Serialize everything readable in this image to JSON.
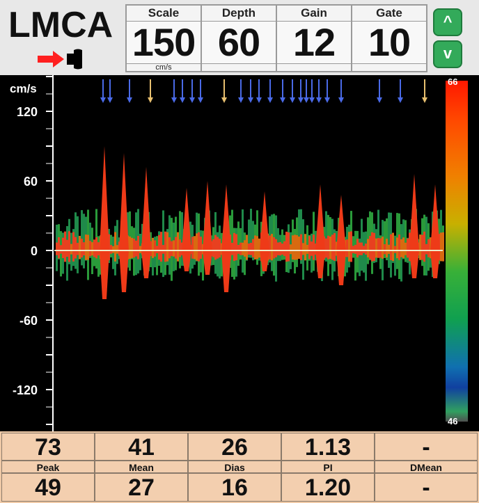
{
  "header": {
    "vessel": "LMCA",
    "scale": {
      "label": "Scale",
      "value": "150",
      "unit": "cm/s"
    },
    "depth": {
      "label": "Depth",
      "value": "60"
    },
    "gain": {
      "label": "Gain",
      "value": "12"
    },
    "gate": {
      "label": "Gate",
      "value": "10"
    },
    "buttons": {
      "up": "^",
      "down": "v"
    }
  },
  "spectrum": {
    "unit": "cm/s",
    "yticks": [
      "120",
      "60",
      "0",
      "-60",
      "-120"
    ],
    "colorbar": {
      "max": "66",
      "min": "46"
    }
  },
  "results": {
    "row1": [
      "73",
      "41",
      "26",
      "1.13",
      "-"
    ],
    "labels": [
      "Peak",
      "Mean",
      "Dias",
      "PI",
      "DMean"
    ],
    "row2": [
      "49",
      "27",
      "16",
      "1.20",
      "-"
    ]
  },
  "colors": {
    "background": "#e8e8e8",
    "spectrum_bg": "#000000",
    "results_bg": "#efc9a6",
    "probe_arrow": "#ff2020",
    "button_green": "#33aa5a"
  }
}
